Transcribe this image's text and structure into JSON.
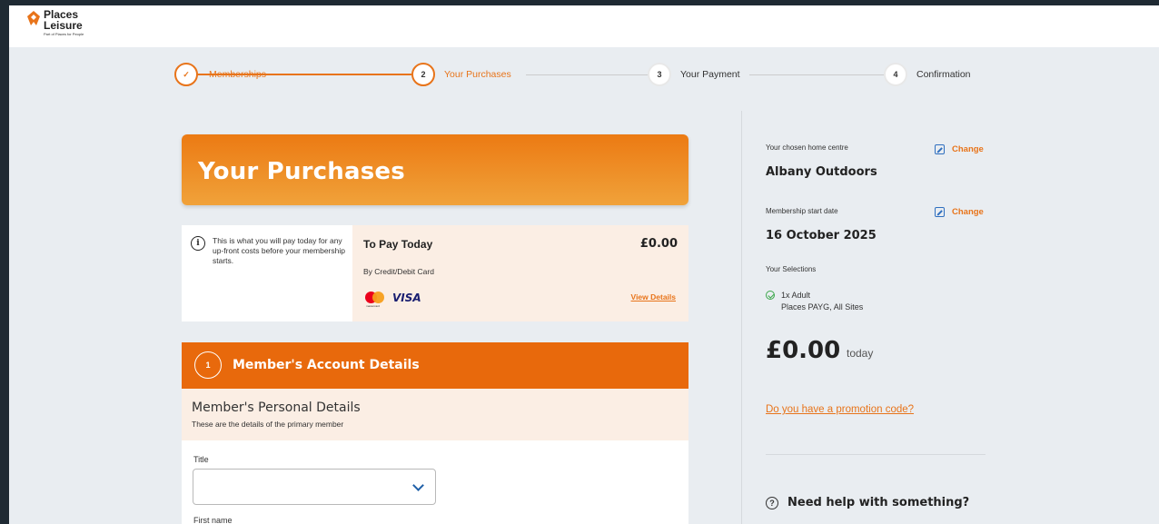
{
  "brand": {
    "line1": "Places",
    "line2": "Leisure",
    "tagline": "Part of Places for People",
    "accent": "#e8741a"
  },
  "stepper": {
    "steps": [
      {
        "number": "✓",
        "label": "Memberships",
        "state": "done"
      },
      {
        "number": "2",
        "label": "Your Purchases",
        "state": "active"
      },
      {
        "number": "3",
        "label": "Your Payment",
        "state": "upcoming"
      },
      {
        "number": "4",
        "label": "Confirmation",
        "state": "upcoming"
      }
    ]
  },
  "hero": {
    "title": "Your Purchases"
  },
  "pay_card": {
    "info": "This is what you will pay today for any up-front costs before your membership starts.",
    "title": "To Pay Today",
    "amount": "£0.00",
    "method": "By Credit/Debit Card",
    "card_brand_1": "mastercard",
    "card_brand_2": "VISA",
    "view_details": "View Details"
  },
  "account": {
    "step_number": "1",
    "title": "Member's Account Details",
    "section_title": "Member's Personal Details",
    "section_sub": "These are the details of the primary member",
    "title_label": "Title",
    "title_value": "",
    "first_name_label": "First name"
  },
  "sidebar": {
    "home_centre_label": "Your chosen home centre",
    "home_centre_value": "Albany Outdoors",
    "change_label": "Change",
    "start_date_label": "Membership start date",
    "start_date_value": "16 October 2025",
    "selections_label": "Your Selections",
    "selection_line1": "1x Adult",
    "selection_line2": "Places PAYG, All Sites",
    "total": "£0.00",
    "total_suffix": "today",
    "promo": "Do you have a promotion code?",
    "help": "Need help with something?"
  }
}
